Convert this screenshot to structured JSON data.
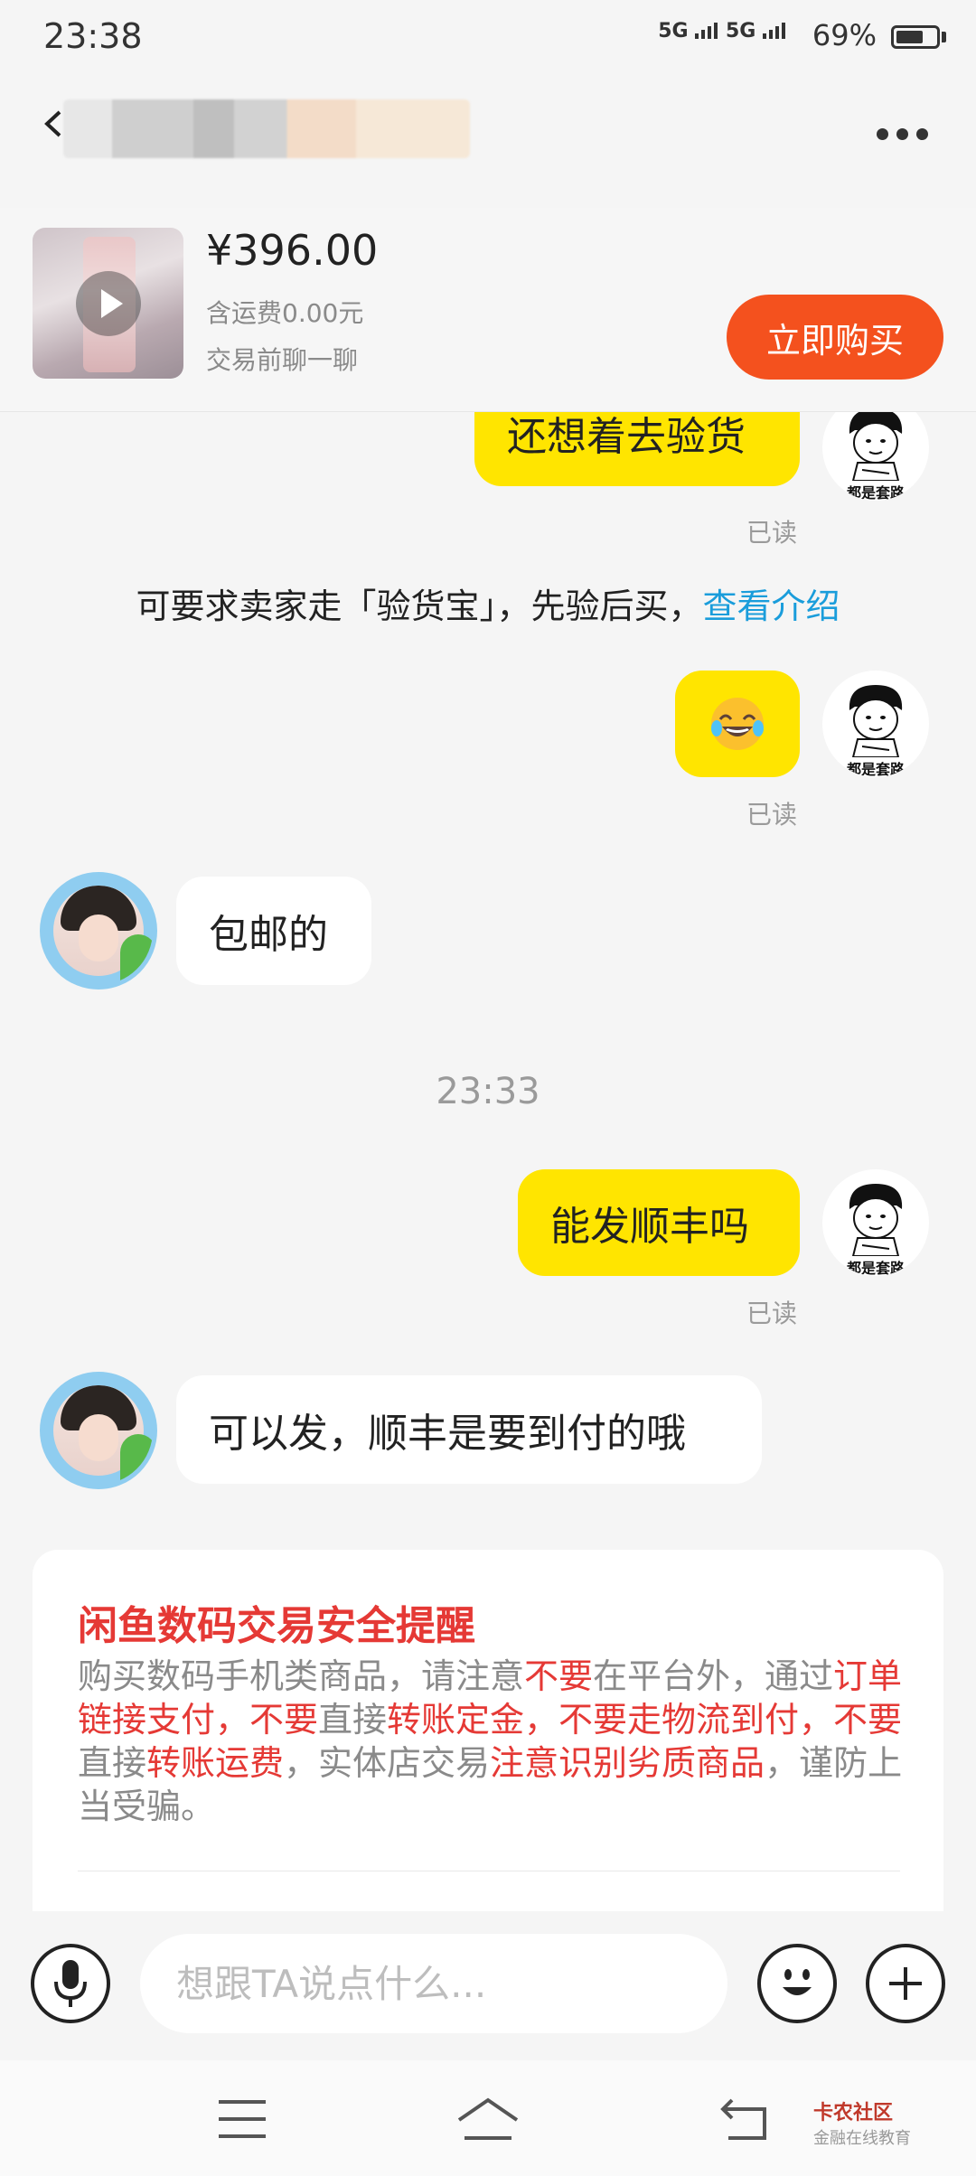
{
  "status_bar": {
    "time": "23:38",
    "signal1": "5G",
    "signal2": "5G",
    "battery": "69%",
    "battery_level": 0.69
  },
  "product": {
    "price": "¥396.00",
    "shipping": "含运费0.00元",
    "note": "交易前聊一聊",
    "buy_label": "立即购买"
  },
  "messages": {
    "m1": {
      "text": "还想着去验货",
      "read": "已读"
    },
    "tip": {
      "text": "可要求卖家走「验货宝」，先验后买，",
      "link": "查看介绍"
    },
    "m2": {
      "read": "已读"
    },
    "m3": {
      "text": "包邮的"
    },
    "timestamp": "23:33",
    "m4": {
      "text": "能发顺丰吗",
      "read": "已读"
    },
    "m5": {
      "text": "可以发，顺丰是要到付的哦"
    }
  },
  "avatar_caption": "都是套路",
  "safety": {
    "title": "闲鱼数码交易安全提醒",
    "p1": "购买数码手机类商品，请注意",
    "p2": "不要",
    "p3": "在平台外，通过",
    "p4": "订单链接支付，不要",
    "p5": "直接",
    "p6": "转账定金，不要走物流到付，不要",
    "p7": "直接",
    "p8": "转账运费",
    "p9": "，实体店交易",
    "p10": "注意识别劣质商品",
    "p11": "，谨防上当受骗。"
  },
  "input": {
    "placeholder": "想跟TA说点什么..."
  },
  "watermark": {
    "brand": "卡农社区",
    "sub": "金融在线教育"
  },
  "colors": {
    "accent_yellow": "#ffe500",
    "buy_orange": "#f4511e",
    "link_blue": "#1a9ddb",
    "warning_red": "#e53935"
  }
}
